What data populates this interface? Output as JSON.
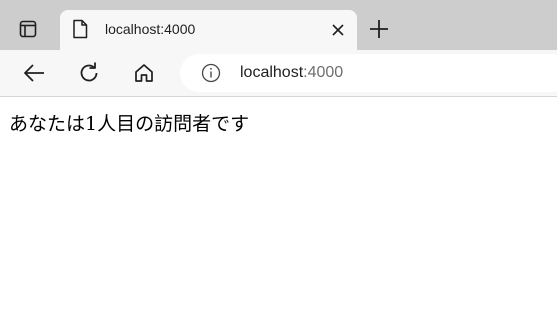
{
  "browser": {
    "tab": {
      "title": "localhost:4000",
      "favicon_icon": "document-icon",
      "close_icon": "close-icon"
    },
    "tab_actions_icon": "tab-actions-icon",
    "new_tab_icon": "plus-icon",
    "toolbar": {
      "back_icon": "arrow-left-icon",
      "reload_icon": "reload-icon",
      "home_icon": "home-icon",
      "site_info_icon": "info-icon",
      "address": {
        "host": "localhost",
        "port": ":4000"
      }
    }
  },
  "page": {
    "message": "あなたは1人目の訪問者です"
  },
  "colors": {
    "tabstrip": "#cdcdcd",
    "active_tab": "#f7f7f7",
    "toolbar": "#f7f7f7",
    "omnibox": "#ffffff",
    "text": "#1f1f1f",
    "muted_text": "#6e6e6e"
  }
}
